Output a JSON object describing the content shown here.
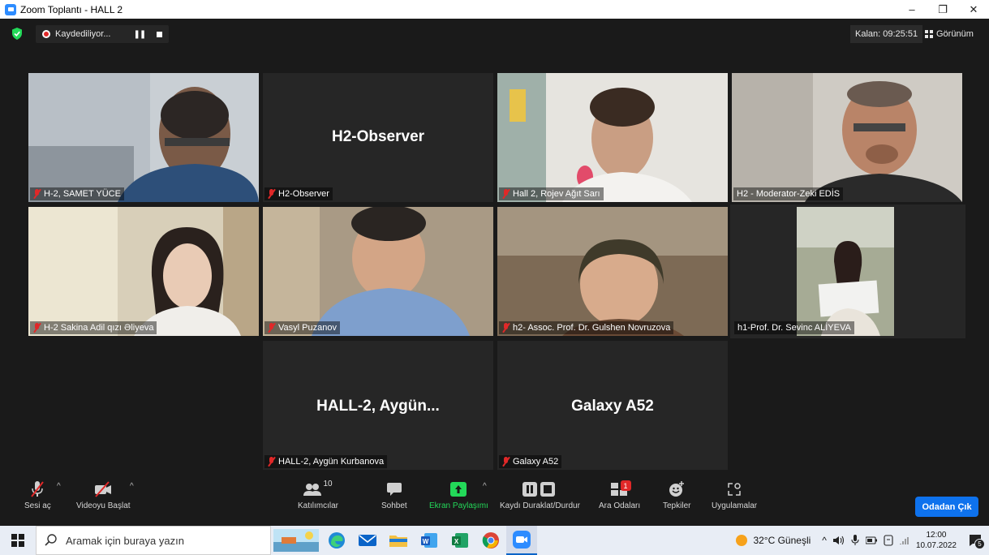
{
  "window": {
    "title": "Zoom Toplantı - HALL 2",
    "minimize": "–",
    "restore": "❐",
    "close": "✕"
  },
  "topbar": {
    "recording_label": "Kaydediliyor...",
    "pause_glyph": "❚❚",
    "timer": "Kalan: 09:25:51",
    "view_label": "Görünüm"
  },
  "tiles": [
    {
      "name": "H-2, SAMET YÜCE",
      "muted": true,
      "video": true
    },
    {
      "name": "H2-Observer",
      "display": "H2-Observer",
      "muted": true,
      "video": false
    },
    {
      "name": "Hall 2, Rojev Ağıt Sarı",
      "muted": true,
      "video": true
    },
    {
      "name": "H2 - Moderator-Zeki EDİS",
      "muted": false,
      "video": true
    },
    {
      "name": "H-2 Sakina Adil qızı Əliyeva",
      "muted": true,
      "video": true
    },
    {
      "name": "Vasyl Puzanov",
      "muted": true,
      "video": true
    },
    {
      "name": "h2- Assoc. Prof. Dr. Gulshen Novruzova",
      "muted": true,
      "video": true
    },
    {
      "name": "h1-Prof. Dr. Sevinc ALİYEVA",
      "muted": false,
      "video": true,
      "active_speaker": true
    },
    {
      "name": "HALL-2, Aygün Kurbanova",
      "display": "HALL-2,  Aygün...",
      "muted": true,
      "video": false
    },
    {
      "name": "Galaxy A52",
      "display": "Galaxy A52",
      "muted": true,
      "video": false
    }
  ],
  "toolbar": {
    "unmute": "Sesi aç",
    "start_video": "Videoyu Başlat",
    "participants": "Katılımcılar",
    "participants_count": "10",
    "chat": "Sohbet",
    "share_screen": "Ekran Paylaşımı",
    "pause_recording": "Kaydı Duraklat/Durdur",
    "breakout": "Ara Odaları",
    "breakout_badge": "1",
    "reactions": "Tepkiler",
    "apps": "Uygulamalar",
    "leave": "Odadan Çık",
    "caret": "^"
  },
  "taskbar": {
    "search_placeholder": "Aramak için buraya yazın",
    "weather": "32°C  Güneşli",
    "time": "12:00",
    "date": "10.07.2022",
    "notification_count": "5",
    "tray_up": "^"
  },
  "colors": {
    "accent": "#0e72ed",
    "share_green": "#23d959",
    "muted_red": "#e02828",
    "active_border": "#e0e48a"
  }
}
